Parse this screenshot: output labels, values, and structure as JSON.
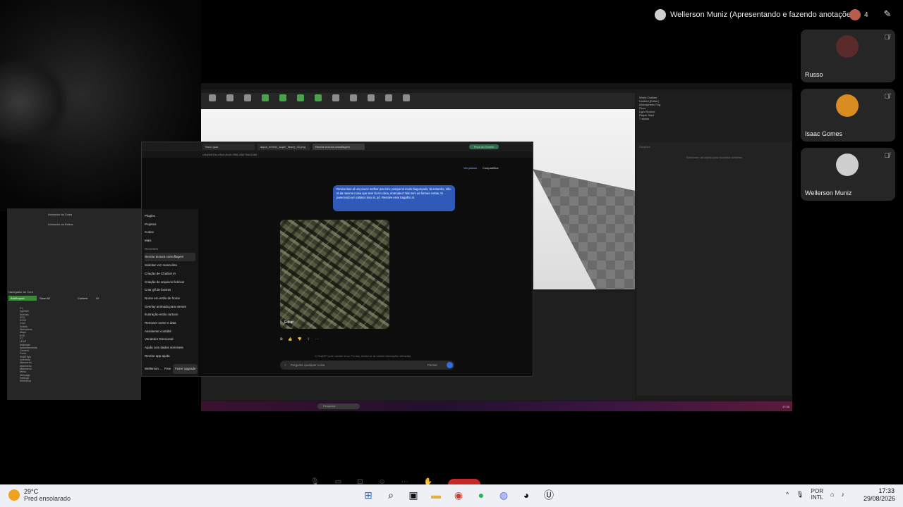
{
  "meeting": {
    "presenter_label": "Wellerson Muniz (Apresentando e fazendo anotações)",
    "participant_count": "4",
    "participants": [
      {
        "name": "Russo",
        "muted": true,
        "avatar_color": "#5a2a2a"
      },
      {
        "name": "Isaac Gomes",
        "muted": true,
        "avatar_color": "#d98c1f"
      },
      {
        "name": "Wellerson Muniz",
        "muted": true,
        "avatar_color": "#cfcfcf"
      }
    ]
  },
  "shared_screen": {
    "outliner": {
      "title": "World Outliner",
      "col_label": "Label",
      "col_type": "Type",
      "items": [
        "Untitled (Editor)",
        "Atmospheric Fog",
        "Floor",
        "Light Source",
        "Player Start"
      ],
      "count": "7 actors"
    },
    "details": {
      "title": "Detalhes",
      "empty_text": "Selecione um objeto para visualizar detalhes"
    },
    "content_browser": {
      "title": "Navegador de Cont",
      "add_import": "Add/Import",
      "save_all": "Save All",
      "path_root": "Content",
      "path_child": "UI",
      "folders": [
        "FX",
        "Qp2000",
        "Animals",
        "RFX",
        "ESS3",
        "Crsd",
        "Scripts",
        "Shinobless",
        "Maps",
        "ESS",
        "FT",
        "LEAP",
        "Materiais",
        "Assembements",
        "Camera",
        "Fonts",
        "ShijElTips",
        "Inventory",
        "Mainmenu",
        "Mainmenu",
        "Mainmenu",
        "Menu",
        "Message",
        "Settings",
        "Workshop"
      ]
    },
    "content_items": [
      "Animador da Coisa",
      "Animador da Esfera"
    ],
    "windows_search": "Pesquisar",
    "screen_clock": "17:33"
  },
  "browser": {
    "tabs": [
      "Novo guia",
      "aquia_emeno_super_heavy_01.png",
      "Recriar textura camuflagem"
    ],
    "goal_button": "Peça ao Gemini",
    "url": "c/6a0b913e-e5e0-8c49-9f58-0f8079a32885",
    "header_actions": {
      "see_plans": "Ver planos",
      "share": "Compartilhar"
    },
    "sidebar": {
      "items": [
        "Plugins",
        "Projetos",
        "Codex",
        "Mais"
      ],
      "recent_header": "Recentes",
      "recent": [
        "Recriar textura camuflagem",
        "Solicitar voz masculina",
        "Criação de Chatbot IA",
        "Criação de arquivos fictícios",
        "Criar gif de lixeiras",
        "Nome em estilo de home",
        "Overlay animada para stream",
        "Ilustração estilo cartoon",
        "Remover nome e data",
        "Assistente contábil",
        "Vendedor Direcional",
        "Ajuda com dados sensíveis",
        "Recriar app ajuda"
      ],
      "user_name": "Wellerson ...",
      "user_plan": "Free",
      "upgrade": "Fazer upgrade"
    },
    "user_message": "Revisa isso aí um pouco melhor pra mim, porque tá muito bagunçado, tá estranho, não tá da mesma coisa que teve lá em cima, entendeu? Não tem as formas certas, tá parecendo um rabisco isso aí, pô. Resolve esse bagulho aí.",
    "image_edit": "Editar",
    "disclaimer": "O ChatGPT pode cometer erros. Por isso, lembre-se de conferir informações relevantes.",
    "input_placeholder": "Pergunte qualquer coisa",
    "think_label": "Pensar"
  },
  "taskbar": {
    "temperature": "29°C",
    "weather": "Pred ensolarado",
    "lang_line1": "POR",
    "lang_line2": "INTL",
    "time": "17:33",
    "date": "29/08/2026"
  }
}
